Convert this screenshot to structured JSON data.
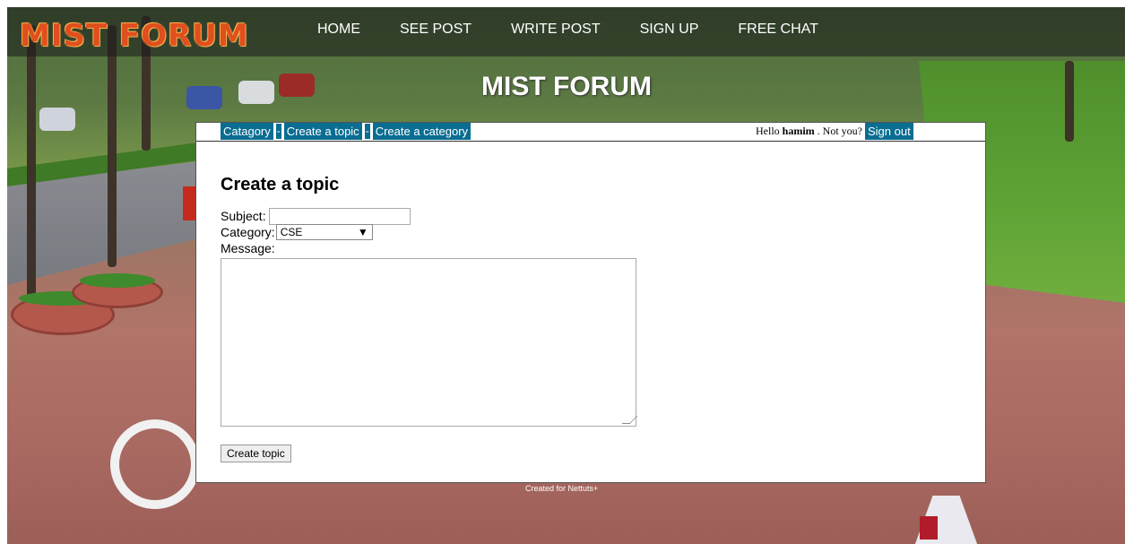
{
  "site": {
    "logo": "MIST FORUM",
    "heading": "MIST FORUM",
    "nav": [
      "HOME",
      "SEE POST",
      "WRITE POST",
      "SIGN UP",
      "FREE CHAT"
    ],
    "footer": "Created for Nettuts+"
  },
  "menu": {
    "links": [
      "Catagory",
      "Create a topic",
      "Create a category"
    ],
    "separator": "-"
  },
  "user": {
    "greeting": "Hello",
    "name": "hamim",
    "not_you": ". Not you?",
    "signout_label": "Sign out"
  },
  "form": {
    "title": "Create a topic",
    "subject_label": "Subject:",
    "subject_value": "",
    "category_label": "Category:",
    "category_selected": "CSE",
    "message_label": "Message:",
    "message_value": "",
    "submit_label": "Create topic"
  },
  "colors": {
    "menu_bg": "#0a6d92",
    "logo": "#e04f1d"
  },
  "icons": {
    "select_arrow": "caret-down-icon",
    "textarea_grip": "resize-grip-icon"
  }
}
